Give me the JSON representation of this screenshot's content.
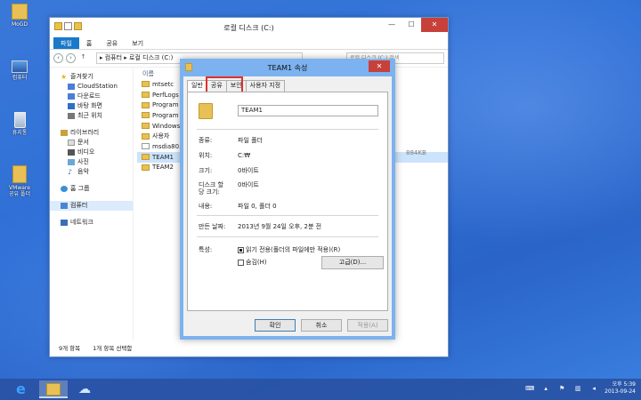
{
  "desktop": {
    "icons": [
      {
        "label": "MoGD"
      },
      {
        "label": "컴퓨터"
      },
      {
        "label": "휴지통"
      },
      {
        "label": "VMware\n공유 폴더"
      }
    ]
  },
  "explorer": {
    "title": "로컬 디스크 (C:)",
    "ribbon_tabs": [
      "파일",
      "홈",
      "공유",
      "보기"
    ],
    "address": "▸ 컴퓨터 ▸ 로컬 디스크 (C:)",
    "search_placeholder": "로컬 디스크 (C:) 검색",
    "column_name": "이름",
    "nav": {
      "favorites": "즐겨찾기",
      "fav_items": [
        "CloudStation",
        "다운로드",
        "바탕 화면",
        "최근 위치"
      ],
      "libraries": "라이브러리",
      "lib_items": [
        "문서",
        "비디오",
        "사진",
        "음악"
      ],
      "homegroup": "홈 그룹",
      "computer": "컴퓨터",
      "network": "네트워크"
    },
    "files": [
      "mtsetc",
      "PerfLogs",
      "Program F",
      "Program F",
      "Windows",
      "사용자",
      "msdia80.d",
      "TEAM1",
      "TEAM2"
    ],
    "partial_size": "884KB",
    "status_count": "9개 항목",
    "status_selected": "1개 항목 선택함"
  },
  "dialog": {
    "title": "TEAM1 속성",
    "tabs": [
      "일반",
      "공유",
      "보안",
      "사용자 지정"
    ],
    "name": "TEAM1",
    "props": [
      {
        "label": "종류:",
        "value": "파일 폴더"
      },
      {
        "label": "위치:",
        "value": "C:₩"
      },
      {
        "label": "크기:",
        "value": "0바이트"
      },
      {
        "label": "디스크 할\n당 크기:",
        "value": "0바이트"
      },
      {
        "label": "내용:",
        "value": "파일 0, 폴더 0"
      },
      {
        "label": "만든 날짜:",
        "value": "2013년 9월 24일 오후, 2분 전"
      }
    ],
    "attributes_label": "특성:",
    "readonly_label": "읽기 전용(폴더의 파일에만 적용)(R)",
    "hidden_label": "숨김(H)",
    "advanced_label": "고급(D)...",
    "ok_label": "확인",
    "cancel_label": "취소",
    "apply_label": "적용(A)"
  },
  "taskbar": {
    "time": "오후 5:39",
    "date": "2013-09-24"
  }
}
